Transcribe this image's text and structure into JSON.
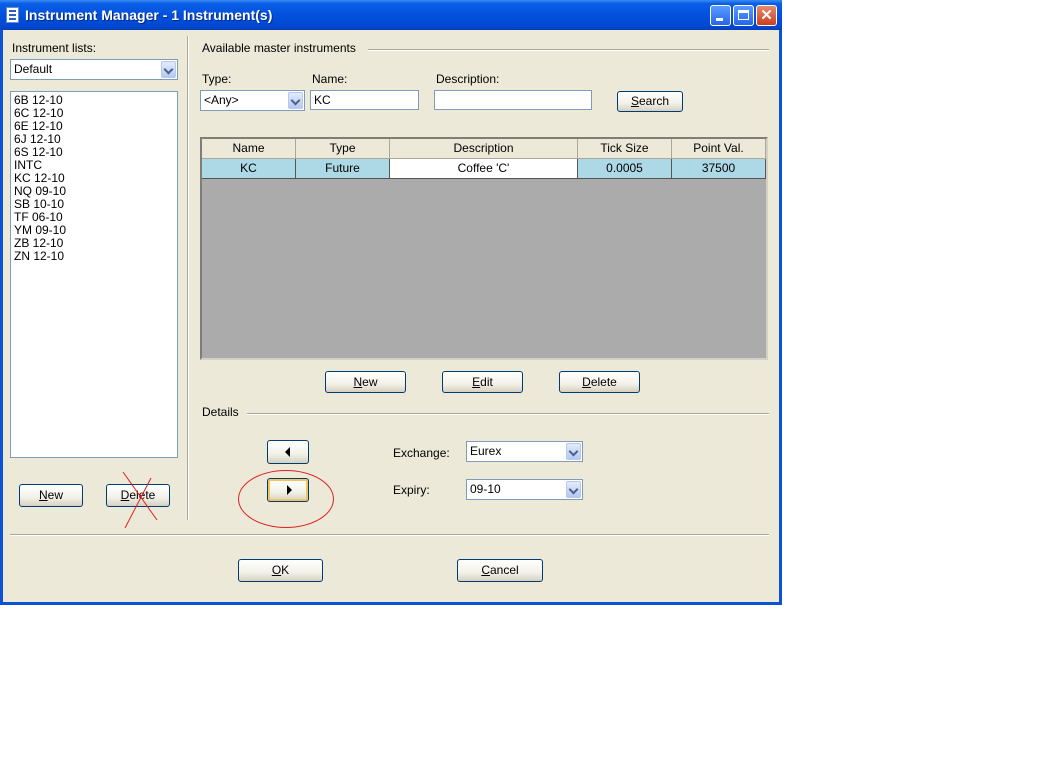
{
  "window": {
    "title": "Instrument Manager - 1 Instrument(s)"
  },
  "left": {
    "lists_label": "Instrument lists:",
    "list_selected": "Default",
    "instruments": [
      "6B 12-10",
      "6C 12-10",
      "6E 12-10",
      "6J 12-10",
      "6S 12-10",
      "INTC",
      "KC 12-10",
      "NQ 09-10",
      "SB 10-10",
      "TF 06-10",
      "YM 09-10",
      "ZB 12-10",
      "ZN 12-10"
    ],
    "new_button": {
      "label": "New",
      "hotkey": "N",
      "rest": "ew"
    },
    "delete_button": {
      "label": "Delete",
      "hotkey": "D",
      "rest": "elete"
    }
  },
  "master": {
    "section_label": "Available master instruments",
    "type_label": "Type:",
    "type_value": "<Any>",
    "name_label": "Name:",
    "name_value": "KC",
    "description_label": "Description:",
    "description_value": "",
    "search_button": {
      "label": "Search",
      "hotkey": "S",
      "rest": "earch"
    },
    "columns": [
      "Name",
      "Type",
      "Description",
      "Tick Size",
      "Point Val."
    ],
    "rows": [
      {
        "name": "KC",
        "type": "Future",
        "description": "Coffee 'C'",
        "tick_size": "0.0005",
        "point_value": "37500"
      }
    ],
    "new_button": {
      "label": "New",
      "hotkey": "N",
      "rest": "ew"
    },
    "edit_button": {
      "label": "Edit",
      "hotkey": "E",
      "rest": "dit"
    },
    "delete_button": {
      "label": "Delete",
      "hotkey": "D",
      "rest": "elete"
    }
  },
  "details": {
    "section_label": "Details",
    "exchange_label": "Exchange:",
    "exchange_value": "Eurex",
    "expiry_label": "Expiry:",
    "expiry_value": "09-10"
  },
  "footer": {
    "ok_button": {
      "label": "OK",
      "hotkey": "O",
      "rest": "K"
    },
    "cancel_button": {
      "label": "Cancel",
      "hotkey": "C",
      "rest": "ancel"
    }
  },
  "annotations": {
    "circle_color": "#e02020",
    "cross_color": "#e02020"
  }
}
